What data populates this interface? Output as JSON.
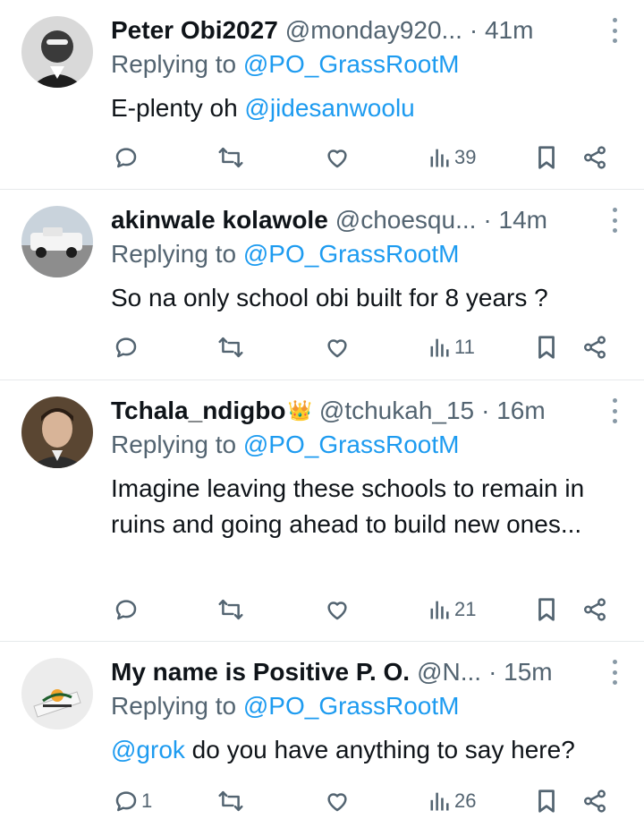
{
  "replies": [
    {
      "name": "Peter Obi2027",
      "handle": "@monday920...",
      "time": "· 41m",
      "replying_prefix": "Replying to",
      "replying_to": "@PO_GrassRootM",
      "text_before": "E-plenty oh",
      "mention": "@jidesanwoolu",
      "text_after": "",
      "reply_count": "",
      "views": "39"
    },
    {
      "name": "akinwale kolawole",
      "handle": "@choesqu...",
      "time": "· 14m",
      "replying_prefix": "Replying to",
      "replying_to": "@PO_GrassRootM",
      "text": "So na only school obi built for 8 years ?",
      "reply_count": "",
      "views": "11"
    },
    {
      "name": "Tchala_ndigbo",
      "badge": "crown",
      "handle": "@tchukah_15",
      "time": "· 16m",
      "replying_prefix": "Replying to",
      "replying_to": "@PO_GrassRootM",
      "text": "Imagine leaving these schools to remain in ruins and going ahead to build new ones...",
      "reply_count": "",
      "views": "21"
    },
    {
      "name": "My name is Positive P. O.",
      "handle": "@N...",
      "time": "· 15m",
      "replying_prefix": "Replying to",
      "replying_to": "@PO_GrassRootM",
      "mention": "@grok",
      "text_after": " do you have anything to say here?",
      "reply_count": "1",
      "views": "26"
    }
  ],
  "icons": {
    "reply": "reply-icon",
    "retweet": "retweet-icon",
    "like": "heart-icon",
    "views": "views-icon",
    "bookmark": "bookmark-icon",
    "share": "share-icon",
    "more": "more-icon"
  },
  "colors": {
    "link": "#1d9bf0",
    "muted": "#536471",
    "text": "#0f1419",
    "divider": "#e6e9eb"
  }
}
